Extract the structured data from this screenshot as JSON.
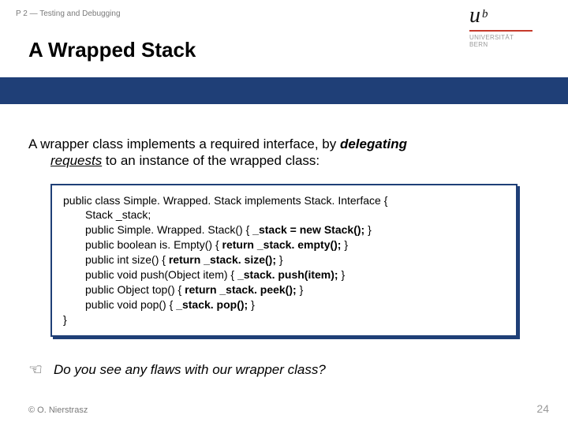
{
  "crumb": "P 2 — Testing and Debugging",
  "logo": {
    "u": "u",
    "b": "b",
    "univ": "UNIVERSITÄT",
    "bern": "BERN"
  },
  "title": "A Wrapped Stack",
  "para": {
    "line1_a": "A wrapper class implements a required interface, by ",
    "line1_b": "delegating",
    "line2_a": "requests",
    "line2_b": " to an instance of the wrapped class:"
  },
  "code": {
    "l0": "public class Simple. Wrapped. Stack implements Stack. Interface {",
    "l1": "Stack _stack;",
    "l2_a": "public Simple. Wrapped. Stack() { ",
    "l2_b": "_stack = new Stack(); ",
    "l2_c": "}",
    "l3_a": "public boolean is. Empty() { ",
    "l3_b": "return _stack. empty(); ",
    "l3_c": "}",
    "l4_a": "public int size() { ",
    "l4_b": "return _stack. size(); ",
    "l4_c": "}",
    "l5_a": "public void push(Object item) { ",
    "l5_b": "_stack. push(item); ",
    "l5_c": "}",
    "l6_a": "public Object top() { ",
    "l6_b": "return _stack. peek(); ",
    "l6_c": "}",
    "l7_a": "public void pop() { ",
    "l7_b": "_stack. pop(); ",
    "l7_c": "}",
    "l8": "}"
  },
  "question": "Do you see any flaws with our wrapper class?",
  "copyright": "© O. Nierstrasz",
  "page": "24"
}
